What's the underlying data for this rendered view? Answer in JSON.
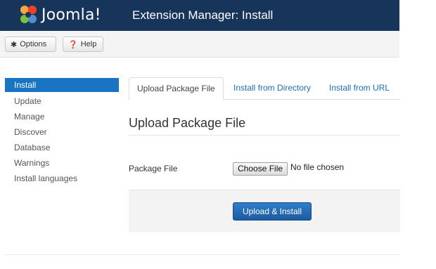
{
  "header": {
    "logo_text": "Joomla!",
    "title": "Extension Manager: Install",
    "colors": {
      "background": "#17345b"
    }
  },
  "toolbar": {
    "options": {
      "label": "Options",
      "icon": "gear-icon"
    },
    "help": {
      "label": "Help",
      "icon": "help-circle-icon"
    }
  },
  "sidebar": {
    "items": [
      {
        "label": "Install",
        "active": true
      },
      {
        "label": "Update"
      },
      {
        "label": "Manage"
      },
      {
        "label": "Discover"
      },
      {
        "label": "Database"
      },
      {
        "label": "Warnings"
      },
      {
        "label": "Install languages"
      }
    ],
    "active_color": "#1a74c4"
  },
  "tabs": [
    {
      "label": "Upload Package File",
      "active": true
    },
    {
      "label": "Install from Directory"
    },
    {
      "label": "Install from URL"
    }
  ],
  "main": {
    "section_title": "Upload Package File",
    "package_file": {
      "label": "Package File",
      "button_label": "Choose File",
      "status": "No file chosen"
    },
    "submit_label": "Upload & Install"
  }
}
